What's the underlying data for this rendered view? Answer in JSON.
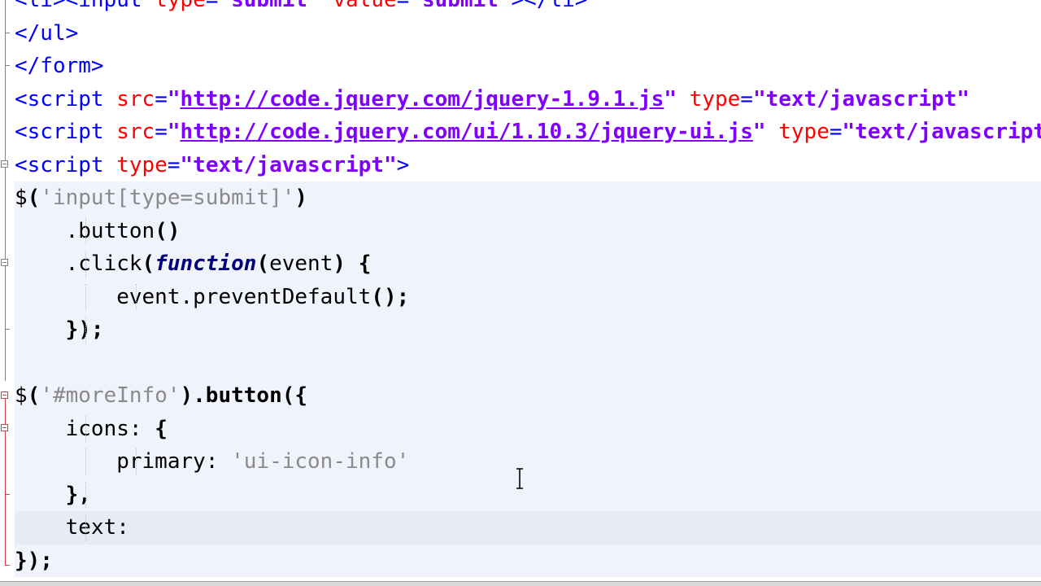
{
  "editor": {
    "lines": [
      {
        "segments": [
          {
            "t": "<li><input ",
            "c": "tag"
          },
          {
            "t": "type",
            "c": "attr"
          },
          {
            "t": "=",
            "c": "tag"
          },
          {
            "t": "\"submit\"",
            "c": "val"
          },
          {
            "t": " ",
            "c": "tag"
          },
          {
            "t": "value",
            "c": "attr"
          },
          {
            "t": "=",
            "c": "tag"
          },
          {
            "t": "\"submit\"",
            "c": "val"
          },
          {
            "t": "></li>",
            "c": "tag"
          }
        ]
      },
      {
        "segments": [
          {
            "t": "</ul>",
            "c": "tag"
          }
        ]
      },
      {
        "segments": [
          {
            "t": "</form>",
            "c": "tag"
          }
        ]
      },
      {
        "segments": [
          {
            "t": "<script ",
            "c": "tag"
          },
          {
            "t": "src",
            "c": "attr"
          },
          {
            "t": "=",
            "c": "tag"
          },
          {
            "t": "\"",
            "c": "val"
          },
          {
            "t": "http://code.jquery.com/jquery-1.9.1.js",
            "c": "url"
          },
          {
            "t": "\"",
            "c": "val"
          },
          {
            "t": " ",
            "c": "tag"
          },
          {
            "t": "type",
            "c": "attr"
          },
          {
            "t": "=",
            "c": "tag"
          },
          {
            "t": "\"text/javascript\"",
            "c": "val"
          }
        ]
      },
      {
        "segments": [
          {
            "t": "<script ",
            "c": "tag"
          },
          {
            "t": "src",
            "c": "attr"
          },
          {
            "t": "=",
            "c": "tag"
          },
          {
            "t": "\"",
            "c": "val"
          },
          {
            "t": "http://code.jquery.com/ui/1.10.3/jquery-ui.js",
            "c": "url"
          },
          {
            "t": "\"",
            "c": "val"
          },
          {
            "t": " ",
            "c": "tag"
          },
          {
            "t": "type",
            "c": "attr"
          },
          {
            "t": "=",
            "c": "tag"
          },
          {
            "t": "\"text/javascript\"",
            "c": "val"
          }
        ]
      },
      {
        "segments": [
          {
            "t": "<script ",
            "c": "tag"
          },
          {
            "t": "type",
            "c": "attr"
          },
          {
            "t": "=",
            "c": "tag"
          },
          {
            "t": "\"text/javascript\"",
            "c": "val"
          },
          {
            "t": ">",
            "c": "tag"
          }
        ]
      },
      {
        "block": true,
        "segments": [
          {
            "t": "$",
            "c": "plain"
          },
          {
            "t": "(",
            "c": "op"
          },
          {
            "t": "'input[type=submit]'",
            "c": "str"
          },
          {
            "t": ")",
            "c": "op"
          }
        ]
      },
      {
        "block": true,
        "guides": [
          1
        ],
        "segments": [
          {
            "t": "    .button",
            "c": "plain"
          },
          {
            "t": "()",
            "c": "op"
          }
        ]
      },
      {
        "block": true,
        "guides": [
          1
        ],
        "segments": [
          {
            "t": "    .click",
            "c": "plain"
          },
          {
            "t": "(",
            "c": "op"
          },
          {
            "t": "function",
            "c": "kw"
          },
          {
            "t": "(",
            "c": "op"
          },
          {
            "t": "event",
            "c": "plain"
          },
          {
            "t": ")",
            "c": "op"
          },
          {
            "t": " ",
            "c": "plain"
          },
          {
            "t": "{",
            "c": "op"
          }
        ]
      },
      {
        "block": true,
        "guides": [
          1,
          5
        ],
        "segments": [
          {
            "t": "        event.preventDefault",
            "c": "plain"
          },
          {
            "t": "();",
            "c": "op"
          }
        ]
      },
      {
        "block": true,
        "guides": [
          1
        ],
        "segments": [
          {
            "t": "    ",
            "c": "plain"
          },
          {
            "t": "});",
            "c": "op"
          }
        ]
      },
      {
        "block": true,
        "segments": []
      },
      {
        "block": true,
        "segments": [
          {
            "t": "$",
            "c": "plain"
          },
          {
            "t": "(",
            "c": "op"
          },
          {
            "t": "'#moreInfo'",
            "c": "str"
          },
          {
            "t": ").button({",
            "c": "op"
          }
        ]
      },
      {
        "block": true,
        "guides": [
          1
        ],
        "segments": [
          {
            "t": "    icons: ",
            "c": "plain"
          },
          {
            "t": "{",
            "c": "op"
          }
        ]
      },
      {
        "block": true,
        "guides": [
          1,
          5
        ],
        "segments": [
          {
            "t": "        primary: ",
            "c": "plain"
          },
          {
            "t": "'ui-icon-info'",
            "c": "str"
          }
        ]
      },
      {
        "block": true,
        "guides": [
          1
        ],
        "segments": [
          {
            "t": "    ",
            "c": "plain"
          },
          {
            "t": "},",
            "c": "op"
          }
        ]
      },
      {
        "block": true,
        "current": true,
        "guides": [
          1
        ],
        "segments": [
          {
            "t": "    text: ",
            "c": "plain"
          }
        ]
      },
      {
        "block": true,
        "segments": [
          {
            "t": "});",
            "c": "op"
          }
        ]
      }
    ]
  },
  "icons": {
    "fold_marker": "fold-minus-icon",
    "mouse_cursor": "text-cursor-icon"
  },
  "colors": {
    "tag": "#0000ff",
    "attribute": "#ff0000",
    "attribute_value": "#8000ff",
    "string": "#8a8a8a",
    "keyword": "#000080",
    "block_highlight": "#f0f3fb",
    "current_line": "#e6ebf6",
    "fold_marker_red": "#d23b3b"
  }
}
